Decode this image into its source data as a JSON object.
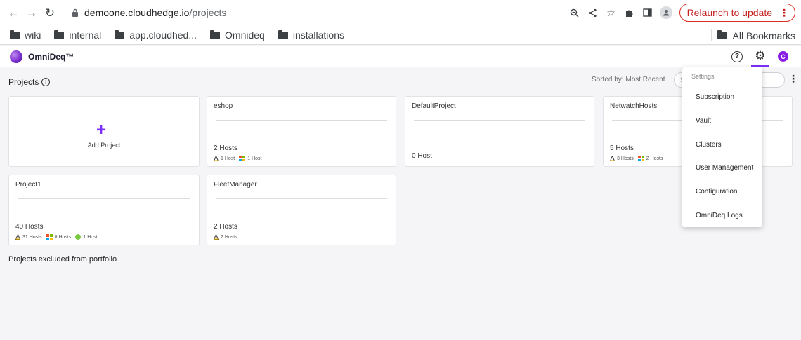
{
  "browser": {
    "url_host": "demoone.cloudhedge.io",
    "url_path": "/projects",
    "relaunch_label": "Relaunch to update",
    "relaunch_menu": "⋮",
    "bookmarks": [
      "wiki",
      "internal",
      "app.cloudhed...",
      "Omnideq",
      "installations"
    ],
    "all_bookmarks": "All Bookmarks"
  },
  "app": {
    "brand": "OmniDeq™",
    "help_glyph": "?",
    "gear_glyph": "⚙",
    "avatar_letter": "C",
    "accent": "#7b2ff7"
  },
  "projects": {
    "title": "Projects",
    "info_glyph": "i",
    "sorted_label": "Sorted by: Most Recent",
    "search_placeholder": "S",
    "more_glyph": "⋮",
    "add_plus": "+",
    "add_label": "Add Project",
    "cards": [
      {
        "name": "eshop",
        "hosts": "2 Hosts",
        "linux": "1 Host",
        "windows": "1 Host"
      },
      {
        "name": "DefaultProject",
        "hosts": "0 Host"
      },
      {
        "name": "NetwatchHosts",
        "hosts": "5 Hosts",
        "linux": "3 Hosts",
        "windows": "2 Hosts"
      },
      {
        "name": "Project1",
        "hosts": "40 Hosts",
        "linux": "31 Hosts",
        "windows": "8 Hosts",
        "other": "1 Host"
      },
      {
        "name": "FleetManager",
        "hosts": "2 Hosts",
        "linux": "2 Hosts"
      }
    ],
    "excluded_title": "Projects excluded from portfolio"
  },
  "settings_menu": {
    "heading": "Settings",
    "items": [
      "Subscription",
      "Vault",
      "Clusters",
      "User Management",
      "Configuration",
      "OmniDeq Logs"
    ]
  }
}
